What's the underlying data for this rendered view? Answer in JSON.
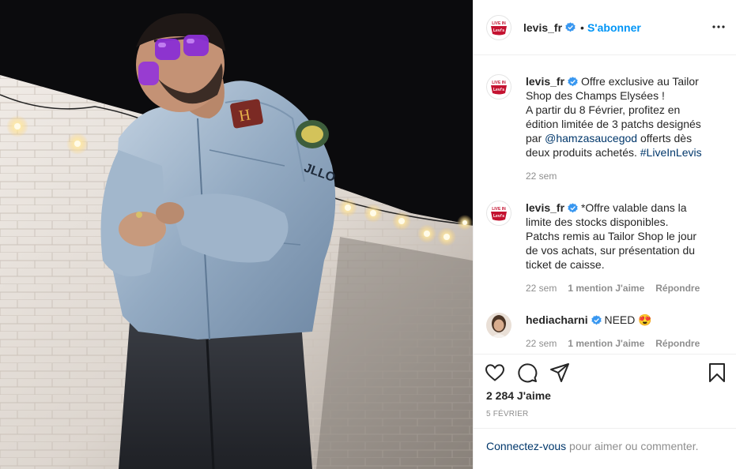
{
  "account": {
    "username": "levis_fr",
    "logo_text": "LIVE IN",
    "logo_brand": "Levi's",
    "follow_label": "S'abonner",
    "separator": "•"
  },
  "comments": [
    {
      "author": "levis_fr",
      "lines": [
        "Offre exclusive au Tailor",
        "Shop des Champs Elysées !",
        "A partir du 8 Février, profitez en",
        "édition limitée de 3 patchs designés"
      ],
      "line5_pre": "par ",
      "mention": "@hamzasaucegod",
      "line5_post": " offerts dès",
      "line6_pre": "deux produits achetés. ",
      "hashtag": "#LiveInLevis",
      "time": "22 sem"
    },
    {
      "author": "levis_fr",
      "lines": [
        "*Offre valable dans la",
        "limite des stocks disponibles.",
        "Patchs remis au Tailor Shop le jour",
        "de vos achats, sur présentation du",
        "ticket de caisse."
      ],
      "time": "22 sem",
      "likes": "1 mention J'aime",
      "reply": "Répondre"
    },
    {
      "author": "hediacharni",
      "text": "NEED",
      "emoji": "😍",
      "time": "22 sem",
      "likes": "1 mention J'aime",
      "reply": "Répondre"
    }
  ],
  "post": {
    "likes": "2 284 J'aime",
    "date": "5 février"
  },
  "login": {
    "link": "Connectez-vous",
    "rest": " pour aimer ou commenter."
  },
  "colors": {
    "accent": "#0095f6",
    "levis_red": "#c41230",
    "text": "#262626",
    "muted": "#8e8e8e",
    "link": "#00376b"
  }
}
